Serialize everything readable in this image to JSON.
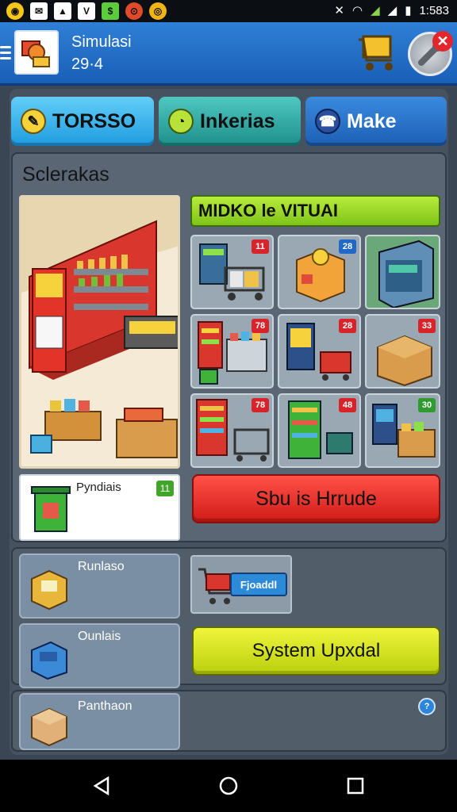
{
  "status_bar": {
    "time": "1:583"
  },
  "app": {
    "title": "Simulasi",
    "subtitle": "29·4"
  },
  "tabs": [
    {
      "label": "TORSSO",
      "icon": "tag-icon"
    },
    {
      "label": "Inkerias",
      "icon": "clock-icon"
    },
    {
      "label": "Make",
      "icon": "phone-icon"
    }
  ],
  "section": {
    "title": "Sclerakas",
    "banner": "MIDKO le VITUAI",
    "grid_badges": [
      "11",
      "28",
      "",
      "78",
      "28",
      "33",
      "78",
      "48",
      "30"
    ],
    "product_card": {
      "label": "Pyndiais",
      "badge": "11"
    },
    "primary_button": "Sbu is Hrrude"
  },
  "section2": {
    "card1_label": "Runlaso",
    "card2_label": "Ounlais",
    "cart_card_label": "Fjoaddl",
    "secondary_button": "System Upxdal"
  },
  "section3": {
    "card_label": "Panthaon",
    "badge": "?"
  },
  "colors": {
    "appbar": "#1a5fb7",
    "primary": "#d11b17",
    "secondary": "#b9cf0c",
    "banner": "#7fc41a"
  }
}
